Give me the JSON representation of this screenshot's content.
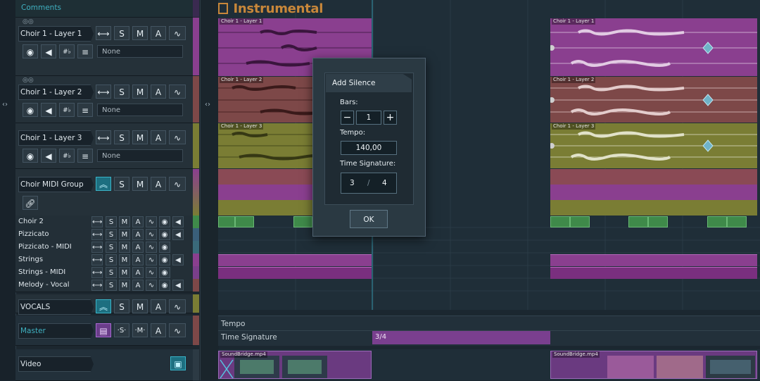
{
  "comments_label": "Comments",
  "project_title": "Instrumental",
  "tracks": [
    {
      "name": "Choir 1 - Layer 1",
      "input": "None"
    },
    {
      "name": "Choir 1 - Layer 2",
      "input": "None"
    },
    {
      "name": "Choir 1 - Layer 3",
      "input": "None"
    }
  ],
  "group_track": {
    "name": "Choir MIDI Group"
  },
  "mini_tracks": [
    {
      "name": "Choir 2"
    },
    {
      "name": "Pizzicato"
    },
    {
      "name": "Pizzicato - MIDI"
    },
    {
      "name": "Strings"
    },
    {
      "name": "Strings - MIDI"
    },
    {
      "name": "Melody - Vocal"
    }
  ],
  "vocals_track": {
    "name": "VOCALS"
  },
  "master_track": {
    "name": "Master"
  },
  "video_track": {
    "name": "Video"
  },
  "buttons": {
    "solo": "S",
    "mute": "M",
    "auto": "A",
    "solo_master": "·S·",
    "mute_master": "·M·"
  },
  "clip_labels": {
    "layer1": "Choir 1 - Layer 1",
    "layer2": "Choir 1 - Layer 2",
    "layer3": "Choir 1 - Layer 3",
    "video": "SoundBridge.mp4"
  },
  "global_tracks": {
    "tempo": "Tempo",
    "time_signature": "Time Signature",
    "ts_clip": "3/4"
  },
  "dialog": {
    "title": "Add Silence",
    "bars_label": "Bars:",
    "bars_value": "1",
    "minus": "−",
    "plus": "+",
    "tempo_label": "Tempo:",
    "tempo_value": "140,00",
    "ts_label": "Time Signature:",
    "ts_numerator": "3",
    "ts_slash": "/",
    "ts_denominator": "4",
    "ok": "OK"
  },
  "colors": {
    "magenta": "#8a3f8f",
    "red_brown": "#7d4848",
    "olive": "#7a7d34",
    "green": "#3f8a4a",
    "teal_accent": "#3ab4c8",
    "title_orange": "#c8873a"
  }
}
